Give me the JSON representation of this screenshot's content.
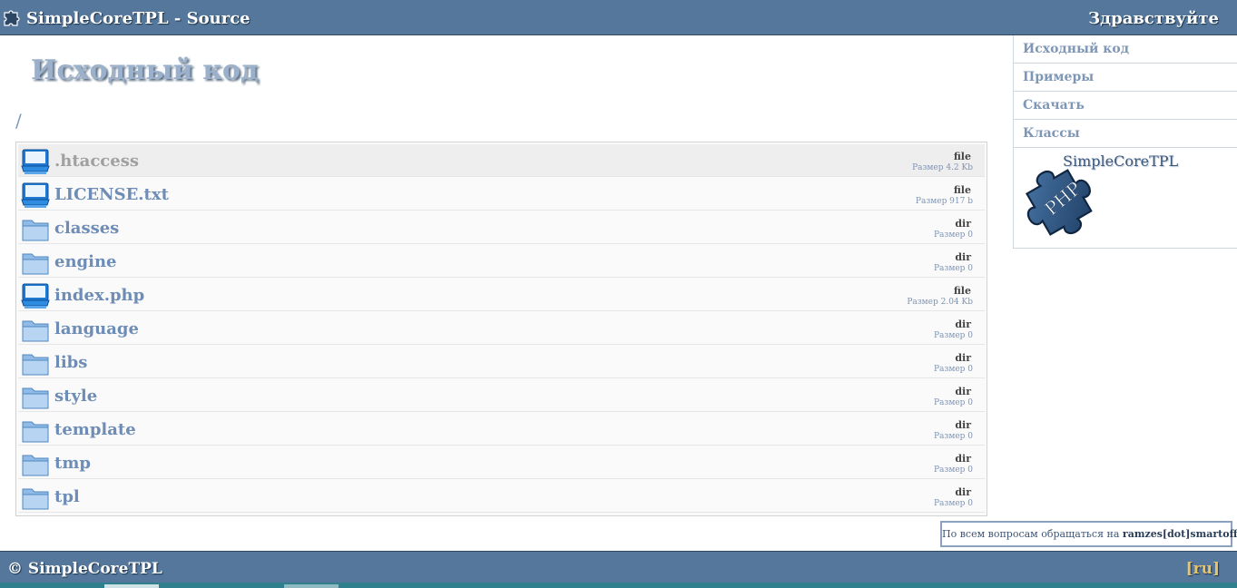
{
  "header": {
    "brand": "SimpleCoreTPL - Source",
    "greeting": "Здравствуйте"
  },
  "page": {
    "title": "Исходный код",
    "path": "/"
  },
  "files": [
    {
      "name": ".htaccess",
      "type": "file",
      "size": "Размер 4.2 Kb",
      "icon": "file-icon"
    },
    {
      "name": "LICENSE.txt",
      "type": "file",
      "size": "Размер 917 b",
      "icon": "file-icon"
    },
    {
      "name": "classes",
      "type": "dir",
      "size": "Размер 0",
      "icon": "folder-icon"
    },
    {
      "name": "engine",
      "type": "dir",
      "size": "Размер 0",
      "icon": "folder-icon"
    },
    {
      "name": "index.php",
      "type": "file",
      "size": "Размер 2.04 Kb",
      "icon": "file-icon"
    },
    {
      "name": "language",
      "type": "dir",
      "size": "Размер 0",
      "icon": "folder-icon"
    },
    {
      "name": "libs",
      "type": "dir",
      "size": "Размер 0",
      "icon": "folder-icon"
    },
    {
      "name": "style",
      "type": "dir",
      "size": "Размер 0",
      "icon": "folder-icon"
    },
    {
      "name": "template",
      "type": "dir",
      "size": "Размер 0",
      "icon": "folder-icon"
    },
    {
      "name": "tmp",
      "type": "dir",
      "size": "Размер 0",
      "icon": "folder-icon"
    },
    {
      "name": "tpl",
      "type": "dir",
      "size": "Размер 0",
      "icon": "folder-icon"
    }
  ],
  "sidebar": {
    "items": [
      {
        "label": "Исходный код"
      },
      {
        "label": "Примеры"
      },
      {
        "label": "Скачать"
      },
      {
        "label": "Классы"
      }
    ],
    "logo_caption": "SimpleCoreTPL",
    "logo_text": "PHP"
  },
  "contact": {
    "prefix": "По всем вопросам обращаться на ",
    "email": "ramzes[dot]smartoff.net"
  },
  "footer": {
    "copyright": "© SimpleCoreTPL",
    "lang": "[ru]"
  },
  "colors": {
    "header_bg": "#54779b",
    "link": "#6d8cb6",
    "lang_accent": "#e8c36a"
  }
}
